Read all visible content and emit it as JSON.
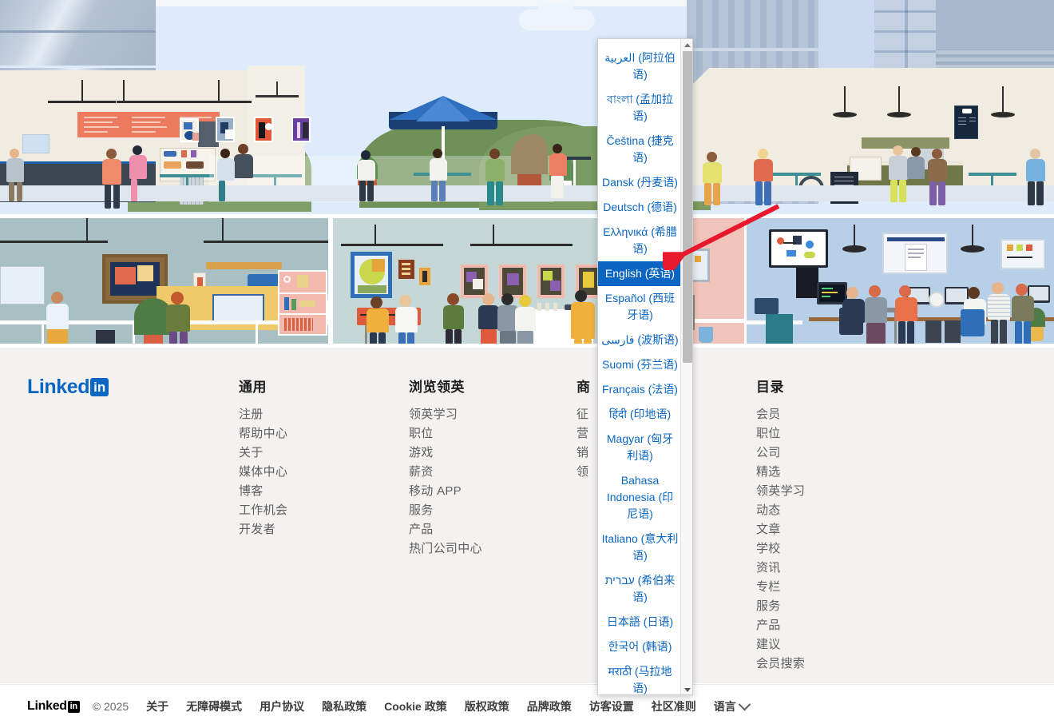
{
  "brand": {
    "name": "Linked",
    "mark": "in",
    "accent": "#0a66c2"
  },
  "footer": {
    "logo_word": "Linked",
    "logo_mark": "in",
    "columns": [
      {
        "heading": "通用",
        "items": [
          "注册",
          "帮助中心",
          "关于",
          "媒体中心",
          "博客",
          "工作机会",
          "开发者"
        ]
      },
      {
        "heading": "浏览领英",
        "items": [
          "领英学习",
          "职位",
          "游戏",
          "薪资",
          "移动 APP",
          "服务",
          "产品",
          "热门公司中心"
        ]
      },
      {
        "heading": "商",
        "items": [
          "征",
          "营",
          "销",
          "领"
        ]
      },
      {
        "heading": "目录",
        "items": [
          "会员",
          "职位",
          "公司",
          "精选",
          "领英学习",
          "动态",
          "文章",
          "学校",
          "资讯",
          "专栏",
          "服务",
          "产品",
          "建议",
          "会员搜索"
        ]
      }
    ]
  },
  "bottombar": {
    "logo_word": "Linked",
    "logo_mark": "in",
    "copyright": "© 2025",
    "links": [
      "关于",
      "无障碍模式",
      "用户协议",
      "隐私政策",
      "Cookie 政策",
      "版权政策",
      "品牌政策",
      "访客设置",
      "社区准则"
    ],
    "language_label": "语言"
  },
  "language_menu": {
    "selected": "English (英语)",
    "items": [
      "العربية (阿拉伯语)",
      "বাংলা (孟加拉语)",
      "Čeština (捷克语)",
      "Dansk (丹麦语)",
      "Deutsch (德语)",
      "Ελληνικά (希腊语)",
      "English (英语)",
      "Español (西班牙语)",
      "فارسی (波斯语)",
      "Suomi (芬兰语)",
      "Français (法语)",
      "हिंदी (印地语)",
      "Magyar (匈牙利语)",
      "Bahasa Indonesia (印尼语)",
      "Italiano (意大利语)",
      "עברית (希伯来语)",
      "日本語 (日语)",
      "한국어 (韩语)",
      "मराठी (马拉地语)"
    ],
    "scroll_up": "▲",
    "scroll_down": "▼"
  },
  "annotation": {
    "arrow_color": "#e8192c"
  }
}
